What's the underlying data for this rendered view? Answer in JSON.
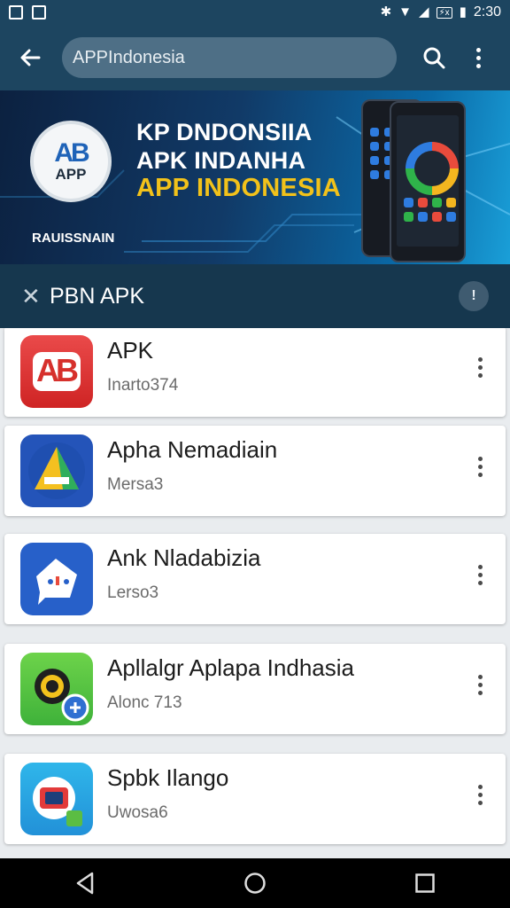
{
  "status_bar": {
    "time": "2:30",
    "battery_label": "⚡x"
  },
  "header": {
    "search_value": "APPIndonesia",
    "back_icon": "arrow-left-icon",
    "search_icon": "search-icon",
    "menu_icon": "more-vert-icon"
  },
  "banner": {
    "logo_letters": "AB",
    "logo_text": "APP",
    "line1": "KP DNDONSIIA",
    "line2": "APK INDANHA",
    "line3": "APP INDONESIA",
    "caption": "RAUISSNAIN"
  },
  "section": {
    "title": "PBN APK",
    "info_label": "!"
  },
  "apps": [
    {
      "name": "APK",
      "subtitle": "Inarto374",
      "icon": "ab-logo-icon",
      "icon_text": "AB"
    },
    {
      "name": "Apha Nemadiain",
      "subtitle": "Mersa3",
      "icon": "triangle-a-icon"
    },
    {
      "name": "Ank Nladabizia",
      "subtitle": "Lerso3",
      "icon": "chat-bubble-icon"
    },
    {
      "name": "Apllalgr Aplapa Indhasia",
      "subtitle": "Alonc 713",
      "icon": "camera-lens-icon"
    },
    {
      "name": "Spbk Ilango",
      "subtitle": "Uwosa6",
      "icon": "tv-icon"
    }
  ],
  "nav": {
    "back": "nav-back-icon",
    "home": "nav-home-icon",
    "recents": "nav-recents-icon"
  },
  "colors": {
    "appbar": "#1d4560",
    "accent_yellow": "#f2c21a",
    "list_bg": "#e9ecef"
  }
}
